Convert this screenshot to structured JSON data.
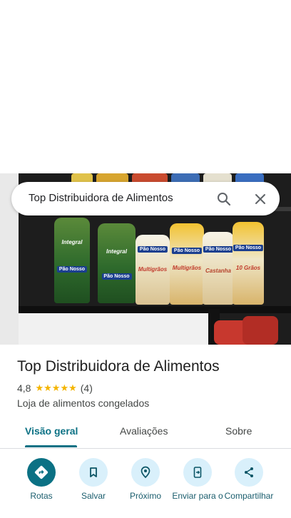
{
  "search": {
    "query": "Top Distribuidora de Alimentos",
    "search_icon": "search-icon",
    "close_icon": "close-icon"
  },
  "place": {
    "name": "Top Distribuidora de Alimentos",
    "rating": "4,8",
    "rating_fraction": 0.96,
    "review_count": "(4)",
    "category": "Loja de alimentos congelados"
  },
  "tabs": [
    {
      "label": "Visão geral",
      "active": true
    },
    {
      "label": "Avaliações",
      "active": false
    },
    {
      "label": "Sobre",
      "active": false
    }
  ],
  "actions": [
    {
      "label": "Rotas",
      "icon": "directions-icon"
    },
    {
      "label": "Salvar",
      "icon": "bookmark-icon"
    },
    {
      "label": "Próximo",
      "icon": "nearby-icon"
    },
    {
      "label": "Enviar para o",
      "icon": "send-to-phone-icon"
    },
    {
      "label": "Compartilhar",
      "icon": "share-icon"
    }
  ],
  "photo": {
    "package_texts": [
      "Integral",
      "Pão Nosso",
      "Integral",
      "Pão Nosso",
      "Multigrãos",
      "Pão Nosso",
      "Castanha",
      "Pão Nosso",
      "10 Grãos"
    ]
  },
  "colors": {
    "accent": "#0b7184",
    "action_bg": "#d9f0fb",
    "star": "#f4b400"
  }
}
